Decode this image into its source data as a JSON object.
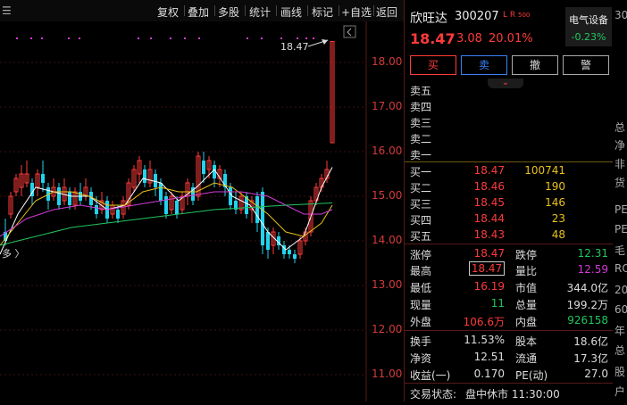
{
  "toolbar": {
    "left_fragment": "☰",
    "buttons": [
      "复权",
      "叠加",
      "多股",
      "统计",
      "画线",
      "标记",
      "+自选",
      "返回"
    ]
  },
  "chart": {
    "corner_label": "多 〉",
    "price_marker": "18.47",
    "y_ticks": [
      "18.00",
      "17.00",
      "16.00",
      "15.00",
      "14.00",
      "13.00",
      "12.00",
      "11.00"
    ]
  },
  "stock": {
    "name": "欣旺达",
    "code": "300207",
    "flags": "L R",
    "flag_sub": "500",
    "price": "18.47",
    "change": "3.08",
    "change_pct": "20.01%",
    "sector": "电气设备",
    "sector_pct": "-0.23%"
  },
  "actions": {
    "buy": "买",
    "sell": "卖",
    "cancel": "撤",
    "alert": "警"
  },
  "expand_icon": "⌄",
  "order_book": {
    "sell": [
      {
        "label": "卖五",
        "price": "",
        "vol": ""
      },
      {
        "label": "卖四",
        "price": "",
        "vol": ""
      },
      {
        "label": "卖三",
        "price": "",
        "vol": ""
      },
      {
        "label": "卖二",
        "price": "",
        "vol": ""
      },
      {
        "label": "卖一",
        "price": "",
        "vol": ""
      }
    ],
    "buy": [
      {
        "label": "买一",
        "price": "18.47",
        "vol": "100741"
      },
      {
        "label": "买二",
        "price": "18.46",
        "vol": "190"
      },
      {
        "label": "买三",
        "price": "18.45",
        "vol": "146"
      },
      {
        "label": "买四",
        "price": "18.44",
        "vol": "23"
      },
      {
        "label": "买五",
        "price": "18.43",
        "vol": "48"
      }
    ]
  },
  "stats": [
    {
      "l1": "涨停",
      "v1": "18.47",
      "l2": "跌停",
      "v2": "12.31"
    },
    {
      "l1": "最高",
      "v1": "18.47",
      "l2": "量比",
      "v2": "12.59"
    },
    {
      "l1": "最低",
      "v1": "16.19",
      "l2": "市值",
      "v2": "344.0亿"
    },
    {
      "l1": "现量",
      "v1": "11",
      "l2": "总量",
      "v2": "199.2万"
    },
    {
      "l1": "外盘",
      "v1": "106.6万",
      "l2": "内盘",
      "v2": "926158"
    }
  ],
  "stats2": [
    {
      "l1": "换手",
      "v1": "11.53%",
      "l2": "股本",
      "v2": "18.6亿"
    },
    {
      "l1": "净资",
      "v1": "12.51",
      "l2": "流通",
      "v2": "17.3亿"
    },
    {
      "l1": "收益(一)",
      "v1": "0.170",
      "l2": "PE(动)",
      "v2": "27.0"
    }
  ],
  "status": {
    "label": "交易状态:",
    "value": "盘中休市 11:30:00"
  },
  "edge_chars": [
    "30",
    "总",
    "净",
    "非",
    "货",
    "PE",
    "PE",
    "毛",
    "RO",
    "20",
    "60",
    "年",
    "总",
    "股",
    "户"
  ],
  "colors": {
    "up": "#ff3b3b",
    "down": "#22d3ee",
    "ma5": "#ffffff",
    "ma10": "#e8c21a",
    "ma20": "#d23bd6",
    "ma60": "#22c55e"
  }
}
